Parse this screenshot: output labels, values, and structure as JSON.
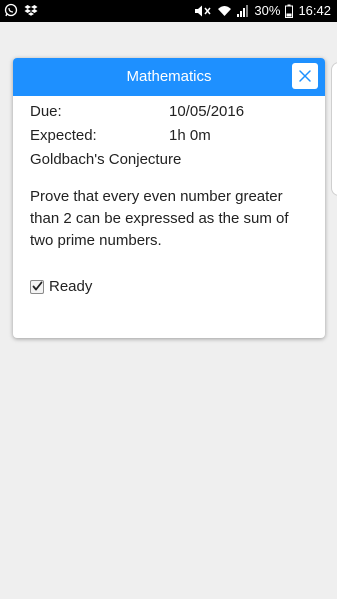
{
  "statusbar": {
    "battery_percent": "30%",
    "time": "16:42",
    "icons": [
      "whatsapp-icon",
      "dropbox-icon",
      "mute-icon",
      "wifi-icon",
      "signal-icon",
      "battery-icon"
    ]
  },
  "dialog": {
    "title": "Mathematics",
    "close_icon": "close-icon",
    "due_label": "Due:",
    "due_value": "10/05/2016",
    "expected_label": "Expected:",
    "expected_value": "1h 0m",
    "task_name": "Goldbach's Conjecture",
    "description": "Prove that every even number greater than 2 can be expressed as the sum of two prime numbers.",
    "ready_label": "Ready",
    "ready_checked": true
  },
  "colors": {
    "header": "#1e90ff",
    "background": "#efefef",
    "statusbar": "#000000"
  }
}
